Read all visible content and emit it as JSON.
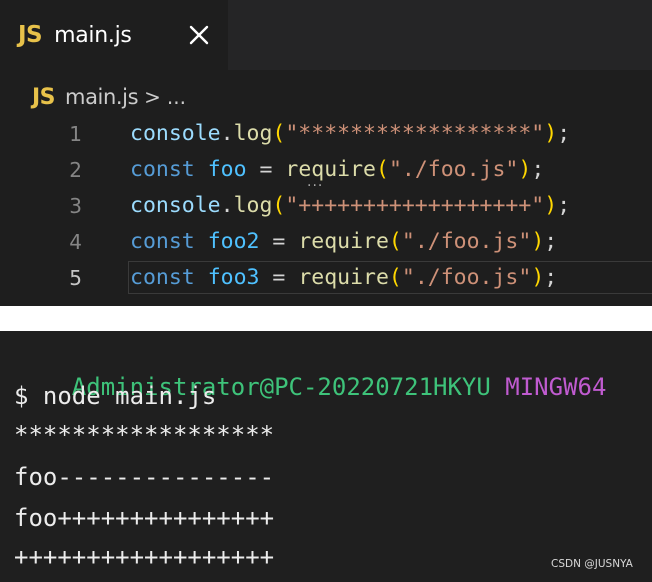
{
  "editor": {
    "tab": {
      "badge": "JS",
      "label": "main.js",
      "close_icon": "close-icon"
    },
    "breadcrumb": {
      "badge": "JS",
      "file": "main.js",
      "separator": ">",
      "more": "..."
    },
    "lines": [
      {
        "number": "1",
        "tokens": [
          {
            "t": "console",
            "c": "ident"
          },
          {
            "t": ".",
            "c": "punc"
          },
          {
            "t": "log",
            "c": "fn"
          },
          {
            "t": "(",
            "c": "paren"
          },
          {
            "t": "\"******************\"",
            "c": "str"
          },
          {
            "t": ")",
            "c": "paren"
          },
          {
            "t": ";",
            "c": "punc"
          }
        ]
      },
      {
        "number": "2",
        "tokens": [
          {
            "t": "const",
            "c": "kw"
          },
          {
            "t": " ",
            "c": "punc"
          },
          {
            "t": "foo",
            "c": "var"
          },
          {
            "t": " = ",
            "c": "punc"
          },
          {
            "t": "require",
            "c": "fn"
          },
          {
            "t": "(",
            "c": "paren"
          },
          {
            "t": "\"./foo.js\"",
            "c": "str"
          },
          {
            "t": ")",
            "c": "paren"
          },
          {
            "t": ";",
            "c": "punc"
          }
        ]
      },
      {
        "number": "3",
        "tokens": [
          {
            "t": "console",
            "c": "ident"
          },
          {
            "t": ".",
            "c": "punc"
          },
          {
            "t": "log",
            "c": "fn"
          },
          {
            "t": "(",
            "c": "paren"
          },
          {
            "t": "\"++++++++++++++++++\"",
            "c": "str"
          },
          {
            "t": ")",
            "c": "paren"
          },
          {
            "t": ";",
            "c": "punc"
          }
        ]
      },
      {
        "number": "4",
        "tokens": [
          {
            "t": "const",
            "c": "kw"
          },
          {
            "t": " ",
            "c": "punc"
          },
          {
            "t": "foo2",
            "c": "var"
          },
          {
            "t": " = ",
            "c": "punc"
          },
          {
            "t": "require",
            "c": "fn"
          },
          {
            "t": "(",
            "c": "paren"
          },
          {
            "t": "\"./foo.js\"",
            "c": "str"
          },
          {
            "t": ")",
            "c": "paren"
          },
          {
            "t": ";",
            "c": "punc"
          }
        ]
      },
      {
        "number": "5",
        "current": true,
        "tokens": [
          {
            "t": "const",
            "c": "kw"
          },
          {
            "t": " ",
            "c": "punc"
          },
          {
            "t": "foo3",
            "c": "var"
          },
          {
            "t": " = ",
            "c": "punc"
          },
          {
            "t": "require",
            "c": "fn"
          },
          {
            "t": "(",
            "c": "paren"
          },
          {
            "t": "\"./foo.js\"",
            "c": "str"
          },
          {
            "t": ")",
            "c": "paren"
          },
          {
            "t": ";",
            "c": "punc"
          }
        ]
      }
    ],
    "hint_dots": "..."
  },
  "terminal": {
    "prompt_user": "Administrator@PC-20220721HKYU",
    "prompt_system": "MINGW64",
    "command": "$ node main.js",
    "output": [
      "******************",
      "foo---------------",
      "foo+++++++++++++++",
      "++++++++++++++++++"
    ]
  },
  "watermark": "CSDN @JUSNYA",
  "colors": {
    "editor_bg": "#1e1e1e",
    "terminal_bg": "#1f1f1f",
    "js_badge": "#e8c24a",
    "prompt_user": "#3ec37a",
    "prompt_system": "#c05bd0"
  }
}
